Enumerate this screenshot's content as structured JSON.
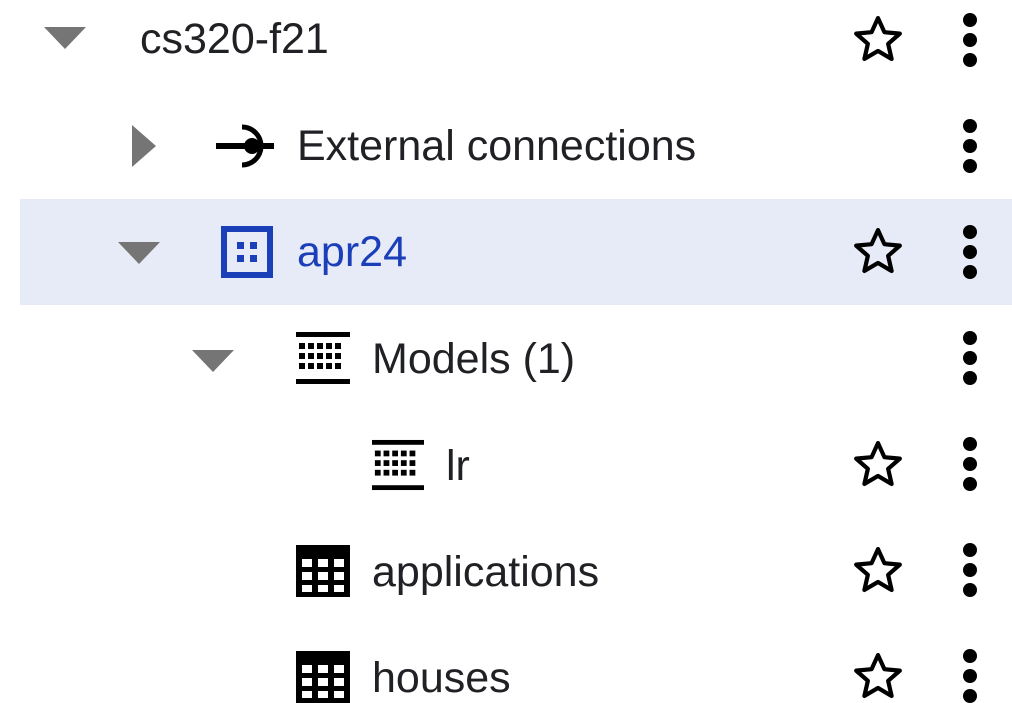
{
  "tree": {
    "rows": [
      {
        "label": "cs320-f21",
        "icon": "project",
        "toggle": "expanded",
        "starred_visible": true
      },
      {
        "label": "External connections",
        "icon": "external-connection-icon",
        "toggle": "collapsed",
        "starred_visible": false
      },
      {
        "label": "apr24",
        "icon": "dataset-icon",
        "toggle": "expanded",
        "starred_visible": true,
        "selected": true
      },
      {
        "label": "Models (1)",
        "icon": "models-icon",
        "toggle": "expanded",
        "starred_visible": false
      },
      {
        "label": "lr",
        "icon": "model-icon",
        "toggle": "none",
        "starred_visible": true
      },
      {
        "label": "applications",
        "icon": "table-icon",
        "toggle": "none",
        "starred_visible": true
      },
      {
        "label": "houses",
        "icon": "table-icon",
        "toggle": "none",
        "starred_visible": true
      }
    ]
  },
  "colors": {
    "selected_background": "#e7ebf8",
    "selected_text": "#1a3fb8",
    "toggle_arrow": "#757575",
    "text": "#202124"
  }
}
